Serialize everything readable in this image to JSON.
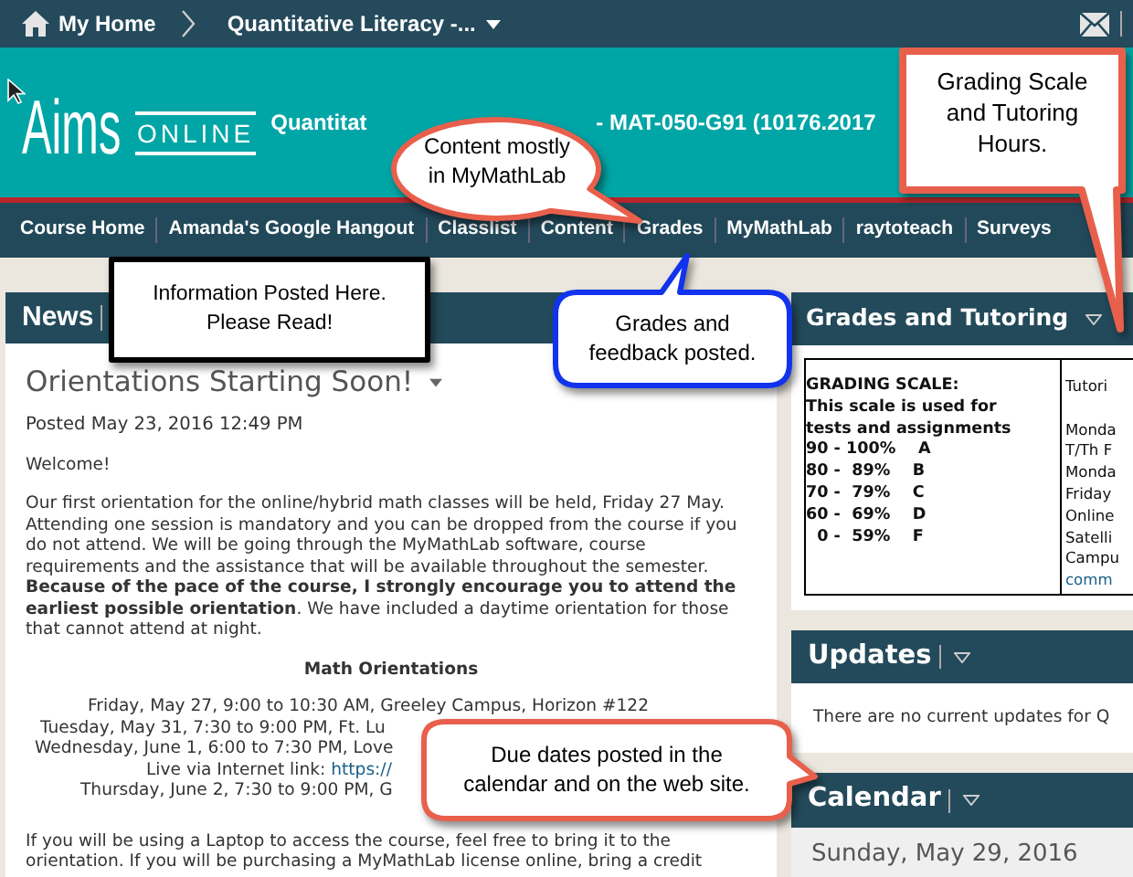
{
  "top_bar": {
    "home": "My Home",
    "course": "Quantitative Literacy -..."
  },
  "header": {
    "logo": {
      "aims": "Aims",
      "online": "ONLINE"
    },
    "title_parts": [
      "Quantitat",
      "- MAT-050-G91 (10176.2017"
    ]
  },
  "nav": [
    {
      "label": "Course Home"
    },
    {
      "label": "Amanda's Google Hangout"
    },
    {
      "label": "Classlist"
    },
    {
      "label": "Content"
    },
    {
      "label": "Grades"
    },
    {
      "label": "MyMathLab"
    },
    {
      "label": "raytoteach"
    },
    {
      "label": "Surveys"
    }
  ],
  "news": {
    "title": "News",
    "item": {
      "title": "Orientations Starting Soon!",
      "posted": "Posted May 23, 2016 12:49 PM",
      "greeting": "Welcome!",
      "paragraph": "Our first orientation for the online/hybrid math classes will be held, Friday 27 May. Attending one session is mandatory and you can be dropped from the course if you do not attend. We will be going through the MyMathLab software, course requirements and the assistance that will be available throughout the semester. **Because of the pace of the course, I strongly encourage you to attend the earliest possible orientation**. We have included a daytime orientation for those that cannot attend at night.",
      "heading": "Math Orientations",
      "schedule": [
        {
          "text": "Friday, May 27, 9:00 to 10:30 AM, Greeley Campus, Horizon #122"
        },
        {
          "text": "Tuesday, May 31, 7:30 to 9:00 PM, Ft. Lu"
        },
        {
          "text": "Wednesday, June 1, 6:00 to 7:30 PM, Love"
        },
        {
          "text": "Live via Internet link:",
          "link": "https://"
        },
        {
          "text": "Thursday, June 2, 7:30 to 9:00 PM, G"
        }
      ],
      "paragraph_2": "If you will be using a Laptop to access the course, feel free to bring it to the orientation.  If you will be purchasing a MyMathLab license online, bring a credit"
    }
  },
  "grades_tutoring": {
    "title": "Grades and Tutoring",
    "scale_lines": [
      "GRADING SCALE:",
      "This scale is used for",
      "tests and assignments",
      "90 - 100%    A",
      "80 -  89%    B",
      "70 -  79%    C",
      "60 -  69%    D",
      "  0 -  59%    F"
    ],
    "tutoring_lines": [
      {
        "kind": "text",
        "text": "Tutori"
      },
      {
        "kind": "gap"
      },
      {
        "kind": "text",
        "text": "Monda"
      },
      {
        "kind": "text",
        "text": "T/Th F"
      },
      {
        "kind": "text",
        "text": "Monda"
      },
      {
        "kind": "text",
        "text": "Friday"
      },
      {
        "kind": "text",
        "text": "Online"
      },
      {
        "kind": "text",
        "text": "Satelli"
      },
      {
        "kind": "text",
        "text": "Campu"
      },
      {
        "kind": "link",
        "text": "comm"
      }
    ]
  },
  "updates": {
    "title": "Updates",
    "message": "There are no current updates for Q"
  },
  "calendar": {
    "title": "Calendar",
    "date": "Sunday, May 29, 2016"
  },
  "callouts": [
    {
      "kind": "ellipse",
      "text": "Content mostly in MyMathLab"
    },
    {
      "kind": "rect-red",
      "text": "Grading Scale and Tutoring Hours."
    },
    {
      "kind": "rect-black",
      "text": "Information Posted Here. Please Read!"
    },
    {
      "kind": "rounded-blue",
      "text": "Grades and feedback posted."
    },
    {
      "kind": "rounded-red",
      "text": "Due dates posted in the calendar and on the web site."
    }
  ]
}
